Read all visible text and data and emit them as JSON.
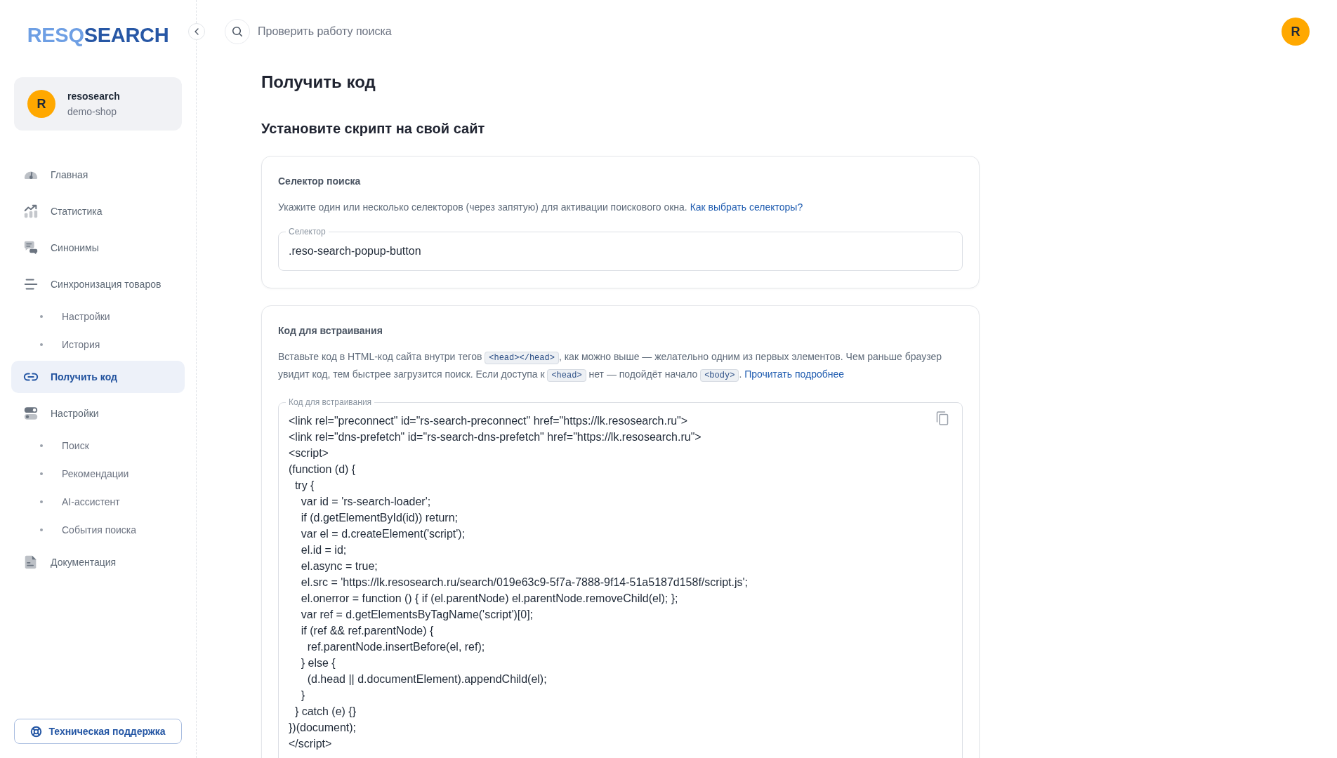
{
  "sidebar": {
    "logo": {
      "part_1": "RESQ",
      "part_2": "SEARCH"
    },
    "account": {
      "avatar": "R",
      "name": "resosearch",
      "shop": "demo-shop"
    },
    "nav": [
      {
        "label": "Главная",
        "selected": false
      },
      {
        "label": "Статистика",
        "selected": false
      },
      {
        "label": "Синонимы",
        "selected": false
      },
      {
        "label": "Синхронизация товаров",
        "selected": false,
        "children": [
          {
            "label": "Настройки",
            "selected": false
          },
          {
            "label": "История",
            "selected": false
          }
        ]
      },
      {
        "label": "Получить код",
        "selected": true
      },
      {
        "label": "Настройки",
        "selected": false,
        "children": [
          {
            "label": "Поиск",
            "selected": false
          },
          {
            "label": "Рекомендации",
            "selected": false
          },
          {
            "label": "AI-ассистент",
            "selected": false
          },
          {
            "label": "События поиска",
            "selected": false
          }
        ]
      },
      {
        "label": "Документация",
        "selected": false
      }
    ],
    "support_button": "Техническая поддержка"
  },
  "topbar": {
    "check_search_button": "Проверить работу поиска",
    "avatar": "R"
  },
  "page": {
    "title": "Получить код",
    "subtitle": "Установите скрипт на свой сайт"
  },
  "cards": [
    {
      "title": "Селектор поиска",
      "description": [
        {
          "kind": "text",
          "text": "Укажите один или несколько селекторов (через запятую) для активации поискового окна. "
        },
        {
          "kind": "link",
          "text": "Как выбрать селекторы?"
        }
      ],
      "field": {
        "label": "Селектор",
        "value": ".reso-search-popup-button"
      }
    },
    {
      "title": "Код для встраивания",
      "description": [
        {
          "kind": "text",
          "text": "Вставьте код в HTML-код сайта внутри тегов "
        },
        {
          "kind": "code",
          "text": "<head></head>"
        },
        {
          "kind": "text",
          "text": ", как можно выше — желательно одним из первых элементов. Чем раньше браузер увидит код, тем быстрее загрузится поиск. Если доступа к "
        },
        {
          "kind": "code",
          "text": "<head>"
        },
        {
          "kind": "text",
          "text": " нет — подойдёт начало "
        },
        {
          "kind": "code",
          "text": "<body>"
        },
        {
          "kind": "text",
          "text": ". "
        },
        {
          "kind": "link",
          "text": "Прочитать подробнее"
        }
      ],
      "code_field": {
        "label": "Код для встраивания",
        "lines": [
          "<link rel=\"preconnect\" id=\"rs-search-preconnect\" href=\"https://lk.resosearch.ru\">",
          "<link rel=\"dns-prefetch\" id=\"rs-search-dns-prefetch\" href=\"https://lk.resosearch.ru\">",
          "<script>",
          "(function (d) {",
          "  try {",
          "    var id = 'rs-search-loader';",
          "    if (d.getElementById(id)) return;",
          "    var el = d.createElement('script');",
          "    el.id = id;",
          "    el.async = true;",
          "    el.src = 'https://lk.resosearch.ru/search/019e63c9-5f7a-7888-9f14-51a5187d158f/script.js';",
          "    el.onerror = function () { if (el.parentNode) el.parentNode.removeChild(el); };",
          "    var ref = d.getElementsByTagName('script')[0];",
          "    if (ref && ref.parentNode) {",
          "      ref.parentNode.insertBefore(el, ref);",
          "    } else {",
          "      (d.head || d.documentElement).appendChild(el);",
          "    }",
          "  } catch (e) {}",
          "})(document);",
          "</script>"
        ]
      }
    }
  ]
}
